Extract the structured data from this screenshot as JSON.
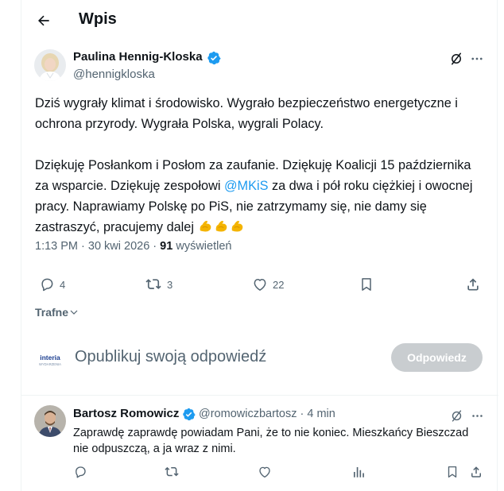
{
  "header": {
    "title": "Wpis"
  },
  "post": {
    "author_name": "Paulina Hennig-Kloska",
    "author_handle": "@hennigkloska",
    "paragraph1": "Dziś wygrały klimat i środowisko. Wygrało bezpieczeństwo energetyczne i ochrona przyrody. Wygrała Polska, wygrali Polacy.",
    "paragraph2_before": "Dziękuję Posłankom i Posłom za zaufanie. Dziękuję Koalicji 15 października za wsparcie. Dziękuję zespołowi ",
    "mention": "@MKiS",
    "paragraph2_after": " za dwa i pół roku ciężkiej i owocnej pracy. Naprawiamy Polskę po PiS, nie zatrzymamy się, nie damy się zastraszyć, pracujemy dalej ",
    "emojis": [
      "flexed-biceps",
      "flexed-biceps",
      "flexed-biceps"
    ],
    "time_date": "1:13 PM · 30 kwi 2026 · ",
    "views_count": "91",
    "views_label": " wyświetleń",
    "replies": "4",
    "reposts": "3",
    "likes": "22"
  },
  "sort": {
    "label": "Trafne"
  },
  "composer": {
    "placeholder": "Opublikuj swoją odpowiedź",
    "reply_button": "Odpowiedz",
    "avatar_logo": [
      "interia",
      "WYDARZENIA"
    ]
  },
  "reply": {
    "author_name": "Bartosz Romowicz",
    "author_handle": "@romowiczbartosz · 4 min",
    "text": "Zaprawdę zaprawdę powiadam Pani, że to nie koniec. Mieszkańcy Bieszczad nie odpuszczą, a ja wraz z nimi."
  },
  "colors": {
    "accent": "#1d9bf0",
    "text": "#0f1419",
    "secondary": "#536471",
    "button_disabled": "#c9cdd0"
  },
  "icons": [
    "back-arrow-icon",
    "verified-badge-icon",
    "grok-icon",
    "more-icon",
    "reply-icon",
    "repost-icon",
    "like-icon",
    "bookmark-icon",
    "share-icon",
    "analytics-icon",
    "chevron-down-icon"
  ]
}
